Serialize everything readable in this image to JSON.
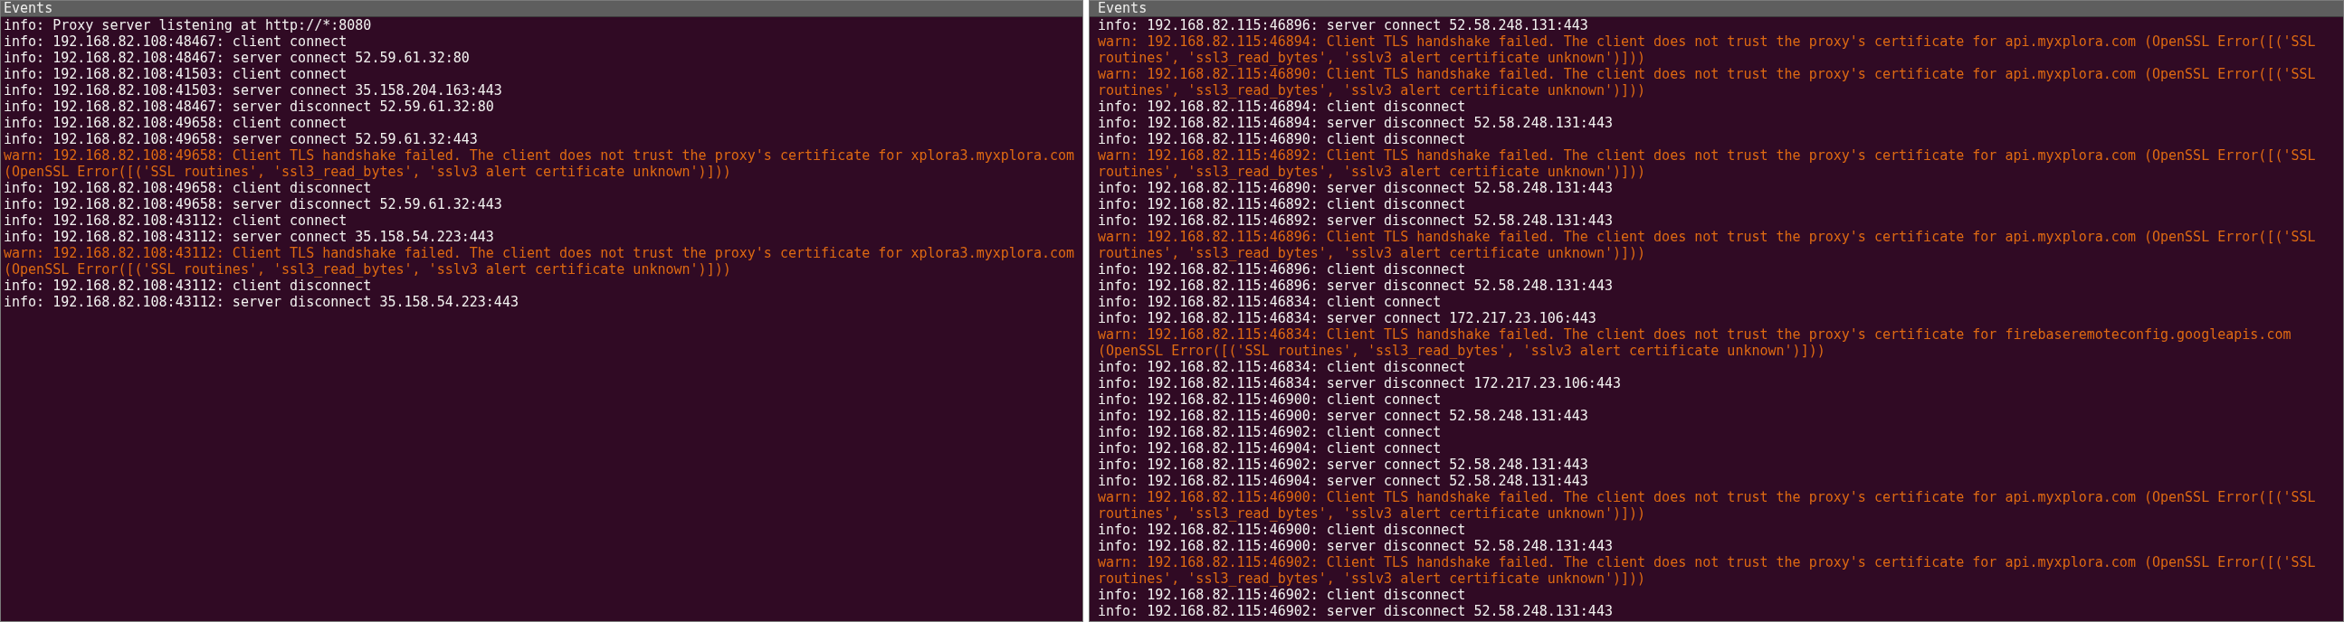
{
  "panes": [
    {
      "title": "Events",
      "entries": [
        {
          "kind": "info",
          "text": "info: Proxy server listening at http://*:8080"
        },
        {
          "kind": "info",
          "text": "info: 192.168.82.108:48467: client connect"
        },
        {
          "kind": "info",
          "text": "info: 192.168.82.108:48467: server connect 52.59.61.32:80"
        },
        {
          "kind": "info",
          "text": "info: 192.168.82.108:41503: client connect"
        },
        {
          "kind": "info",
          "text": "info: 192.168.82.108:41503: server connect 35.158.204.163:443"
        },
        {
          "kind": "info",
          "text": "info: 192.168.82.108:48467: server disconnect 52.59.61.32:80"
        },
        {
          "kind": "info",
          "text": "info: 192.168.82.108:49658: client connect"
        },
        {
          "kind": "info",
          "text": "info: 192.168.82.108:49658: server connect 52.59.61.32:443"
        },
        {
          "kind": "warn",
          "text": "warn: 192.168.82.108:49658: Client TLS handshake failed. The client does not trust the proxy's certificate for xplora3.myxplora.com (OpenSSL Error([('SSL routines', 'ssl3_read_bytes', 'sslv3 alert certificate unknown')]))"
        },
        {
          "kind": "info",
          "text": "info: 192.168.82.108:49658: client disconnect"
        },
        {
          "kind": "info",
          "text": "info: 192.168.82.108:49658: server disconnect 52.59.61.32:443"
        },
        {
          "kind": "info",
          "text": "info: 192.168.82.108:43112: client connect"
        },
        {
          "kind": "info",
          "text": "info: 192.168.82.108:43112: server connect 35.158.54.223:443"
        },
        {
          "kind": "warn",
          "text": "warn: 192.168.82.108:43112: Client TLS handshake failed. The client does not trust the proxy's certificate for xplora3.myxplora.com (OpenSSL Error([('SSL routines', 'ssl3_read_bytes', 'sslv3 alert certificate unknown')]))"
        },
        {
          "kind": "info",
          "text": "info: 192.168.82.108:43112: client disconnect"
        },
        {
          "kind": "info",
          "text": "info: 192.168.82.108:43112: server disconnect 35.158.54.223:443"
        }
      ]
    },
    {
      "title": "Events",
      "entries": [
        {
          "kind": "info",
          "text": "info: 192.168.82.115:46896: server connect 52.58.248.131:443"
        },
        {
          "kind": "warn",
          "text": "warn: 192.168.82.115:46894: Client TLS handshake failed. The client does not trust the proxy's certificate for api.myxplora.com (OpenSSL Error([('SSL routines', 'ssl3_read_bytes', 'sslv3 alert certificate unknown')]))"
        },
        {
          "kind": "warn",
          "text": "warn: 192.168.82.115:46890: Client TLS handshake failed. The client does not trust the proxy's certificate for api.myxplora.com (OpenSSL Error([('SSL routines', 'ssl3_read_bytes', 'sslv3 alert certificate unknown')]))"
        },
        {
          "kind": "info",
          "text": "info: 192.168.82.115:46894: client disconnect"
        },
        {
          "kind": "info",
          "text": "info: 192.168.82.115:46894: server disconnect 52.58.248.131:443"
        },
        {
          "kind": "info",
          "text": "info: 192.168.82.115:46890: client disconnect"
        },
        {
          "kind": "warn",
          "text": "warn: 192.168.82.115:46892: Client TLS handshake failed. The client does not trust the proxy's certificate for api.myxplora.com (OpenSSL Error([('SSL routines', 'ssl3_read_bytes', 'sslv3 alert certificate unknown')]))"
        },
        {
          "kind": "info",
          "text": "info: 192.168.82.115:46890: server disconnect 52.58.248.131:443"
        },
        {
          "kind": "info",
          "text": "info: 192.168.82.115:46892: client disconnect"
        },
        {
          "kind": "info",
          "text": "info: 192.168.82.115:46892: server disconnect 52.58.248.131:443"
        },
        {
          "kind": "warn",
          "text": "warn: 192.168.82.115:46896: Client TLS handshake failed. The client does not trust the proxy's certificate for api.myxplora.com (OpenSSL Error([('SSL routines', 'ssl3_read_bytes', 'sslv3 alert certificate unknown')]))"
        },
        {
          "kind": "info",
          "text": "info: 192.168.82.115:46896: client disconnect"
        },
        {
          "kind": "info",
          "text": "info: 192.168.82.115:46896: server disconnect 52.58.248.131:443"
        },
        {
          "kind": "info",
          "text": "info: 192.168.82.115:46834: client connect"
        },
        {
          "kind": "info",
          "text": "info: 192.168.82.115:46834: server connect 172.217.23.106:443"
        },
        {
          "kind": "warn",
          "text": "warn: 192.168.82.115:46834: Client TLS handshake failed. The client does not trust the proxy's certificate for firebaseremoteconfig.googleapis.com (OpenSSL Error([('SSL routines', 'ssl3_read_bytes', 'sslv3 alert certificate unknown')]))"
        },
        {
          "kind": "info",
          "text": "info: 192.168.82.115:46834: client disconnect"
        },
        {
          "kind": "info",
          "text": "info: 192.168.82.115:46834: server disconnect 172.217.23.106:443"
        },
        {
          "kind": "info",
          "text": "info: 192.168.82.115:46900: client connect"
        },
        {
          "kind": "info",
          "text": "info: 192.168.82.115:46900: server connect 52.58.248.131:443"
        },
        {
          "kind": "info",
          "text": "info: 192.168.82.115:46902: client connect"
        },
        {
          "kind": "info",
          "text": "info: 192.168.82.115:46904: client connect"
        },
        {
          "kind": "info",
          "text": "info: 192.168.82.115:46902: server connect 52.58.248.131:443"
        },
        {
          "kind": "info",
          "text": "info: 192.168.82.115:46904: server connect 52.58.248.131:443"
        },
        {
          "kind": "warn",
          "text": "warn: 192.168.82.115:46900: Client TLS handshake failed. The client does not trust the proxy's certificate for api.myxplora.com (OpenSSL Error([('SSL routines', 'ssl3_read_bytes', 'sslv3 alert certificate unknown')]))"
        },
        {
          "kind": "info",
          "text": "info: 192.168.82.115:46900: client disconnect"
        },
        {
          "kind": "info",
          "text": "info: 192.168.82.115:46900: server disconnect 52.58.248.131:443"
        },
        {
          "kind": "warn",
          "text": "warn: 192.168.82.115:46902: Client TLS handshake failed. The client does not trust the proxy's certificate for api.myxplora.com (OpenSSL Error([('SSL routines', 'ssl3_read_bytes', 'sslv3 alert certificate unknown')]))"
        },
        {
          "kind": "info",
          "text": "info: 192.168.82.115:46902: client disconnect"
        },
        {
          "kind": "info",
          "text": "info: 192.168.82.115:46902: server disconnect 52.58.248.131:443"
        }
      ]
    }
  ]
}
